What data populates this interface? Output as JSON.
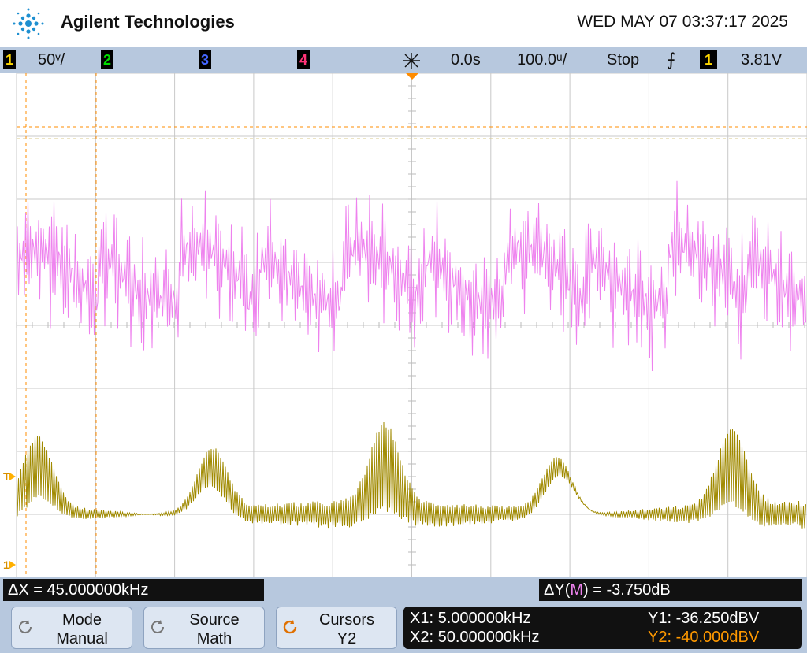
{
  "brand": "Agilent Technologies",
  "datetime": "WED MAY 07 03:37:17 2025",
  "status": {
    "ch1": "1",
    "ch1_scale": "50ᵛ/",
    "ch2": "2",
    "ch3": "3",
    "ch4": "4",
    "trig_icon": "trigger-icon",
    "delay": "0.0s",
    "timebase": "100.0ᵘ/",
    "run_state": "Stop",
    "slope": "⨍",
    "trig_src": "1",
    "trig_level": "3.81V"
  },
  "markers": {
    "trigger_level": "T",
    "ch1_ground": "1"
  },
  "readouts": {
    "delta_x": "ΔX = 45.000000kHz",
    "delta_y_prefix": "ΔY(",
    "delta_y_src": "M",
    "delta_y_suffix": ") = -3.750dB"
  },
  "softkeys": [
    {
      "l1": "Mode",
      "l2": "Manual",
      "icon": "rotate-icon"
    },
    {
      "l1": "Source",
      "l2": "Math",
      "icon": "rotate-icon"
    },
    {
      "l1": "Cursors",
      "l2": "Y2",
      "icon": "rotate-icon-orange"
    }
  ],
  "cursors": {
    "x1": "X1: 5.000000kHz",
    "x2": "X2: 50.000000kHz",
    "y1": "Y1: -36.250dBV",
    "y2": "Y2: -40.000dBV"
  },
  "colors": {
    "math": "#ee82ee",
    "ch1": "#a08a00",
    "cursor": "#ff8c00",
    "ch2": "#00cc00",
    "ch3": "#3355ff",
    "ch4": "#ff2266",
    "grid": "#c8c8c8"
  }
}
